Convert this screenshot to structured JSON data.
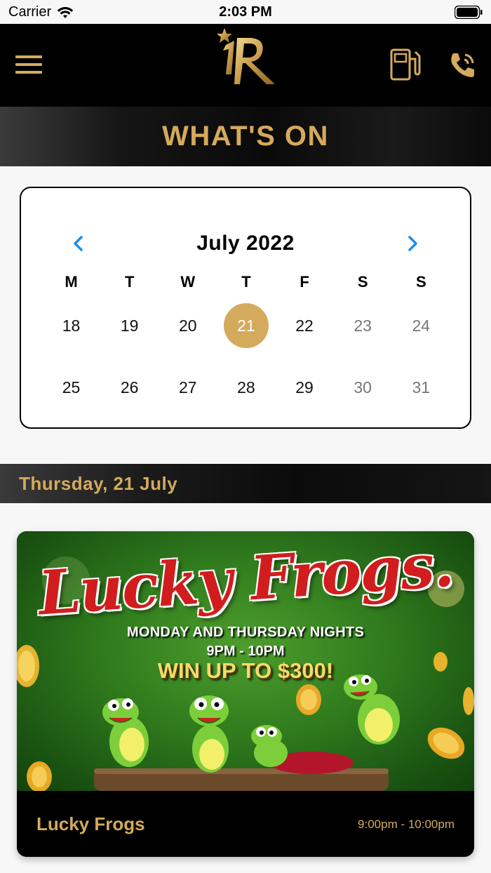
{
  "status_bar": {
    "carrier": "Carrier",
    "time": "2:03 PM"
  },
  "header": {
    "menu_icon": "hamburger-menu-icon",
    "logo_icon": "star-r-logo",
    "fuel_icon": "fuel-pump-icon",
    "phone_icon": "phone-call-icon"
  },
  "page": {
    "title": "WHAT'S ON"
  },
  "calendar": {
    "month_label": "July 2022",
    "prev_icon": "chevron-left-icon",
    "next_icon": "chevron-right-icon",
    "weekdays": [
      "M",
      "T",
      "W",
      "T",
      "F",
      "S",
      "S"
    ],
    "weeks": [
      [
        "18",
        "19",
        "20",
        "21",
        "22",
        "23",
        "24"
      ],
      [
        "25",
        "26",
        "27",
        "28",
        "29",
        "30",
        "31"
      ]
    ],
    "selected_day": "21"
  },
  "date_banner": {
    "label": "Thursday, 21 July"
  },
  "event": {
    "name": "Lucky Frogs",
    "time": "9:00pm - 10:00pm",
    "image": {
      "headline": "Lucky Frogs.",
      "line1": "MONDAY AND THURSDAY NIGHTS",
      "line2": "9PM - 10PM",
      "line3": "WIN UP TO $300!"
    }
  },
  "colors": {
    "accent_gold": "#d4aa5c",
    "header_bg": "#000000",
    "chevron_blue": "#1a8cf0"
  }
}
